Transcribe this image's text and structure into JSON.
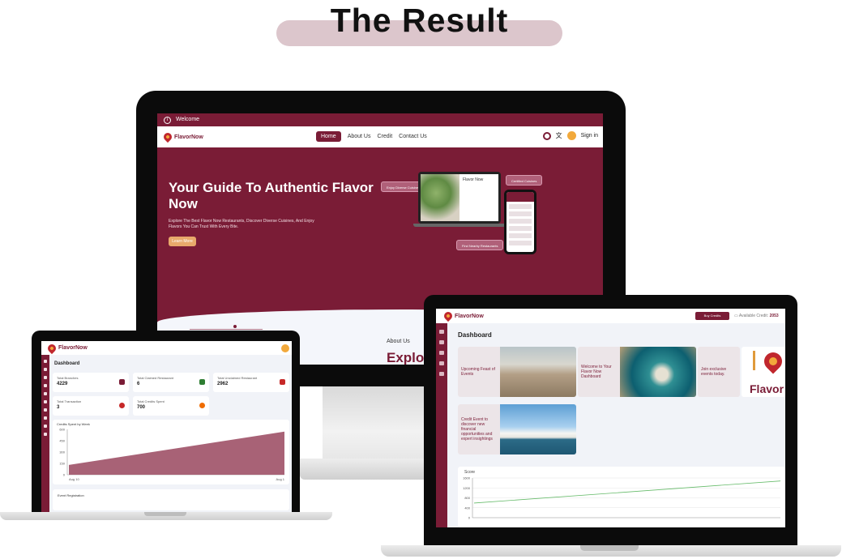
{
  "heading": "The Result",
  "colors": {
    "brand": "#7a1c36",
    "accent": "#f2a93b",
    "pill": "#dcc6cc",
    "button": "#e8a96b"
  },
  "desktop": {
    "welcome_text": "Welcome",
    "logo_text": "FlavorNow",
    "nav": {
      "home": "Home",
      "about": "About Us",
      "credit": "Credit",
      "contact": "Contact Us",
      "signin": "Sign in"
    },
    "hero": {
      "title": "Your Guide To Authentic Flavor Now",
      "subtitle": "Explore The Best Flavor Now Restaurants, Discover Diverse Cuisines, And Enjoy Flavors You Can Trust With Every Bite.",
      "button": "Learn More",
      "chip_left": "Enjoy Diverse Cuisines",
      "chip_right": "Certified Cuisines",
      "chip_bottom": "Find Nearby Restaurants",
      "mock_title": "Flavor Now"
    },
    "about_label": "About Us",
    "explore_label": "Explo"
  },
  "tablet": {
    "logo_text": "FlavorNow",
    "title": "Dashboard",
    "stats": [
      {
        "label": "Total Branches",
        "value": "4229",
        "icon": "store-icon",
        "color": "#7a1c36"
      },
      {
        "label": "Total Claimed Restaurant",
        "value": "6",
        "icon": "fork-knife-icon",
        "color": "#2e7d32"
      },
      {
        "label": "Total Unclaimed Restaurant",
        "value": "2962",
        "icon": "no-food-icon",
        "color": "#c62828"
      },
      {
        "label": "Total Transaction",
        "value": "3",
        "icon": "dollar-icon",
        "color": "#c62828"
      },
      {
        "label": "Total Credits Spent",
        "value": "700",
        "icon": "dollar-icon",
        "color": "#ef6c00"
      }
    ],
    "chart_title": "Credits Spent by Week",
    "event_title": "Event Registration"
  },
  "laptop": {
    "logo_text": "FlavorNow",
    "buy_credits": "Buy Credits",
    "credit_label": "Available Credit:",
    "credit_value": "2053",
    "title": "Dashboard",
    "cards": [
      {
        "text": "Upcoming Feast of Events"
      },
      {
        "text": "Welcome to Your Flavor Now Dashboard"
      },
      {
        "text": "Join exclusive events today."
      },
      {
        "text": "Credit Event to discover new financial opportunities and expert insightings"
      }
    ],
    "brand_word": "Flavor",
    "chart_title": "Score"
  },
  "chart_data": [
    {
      "type": "area",
      "title": "Credits Spent by Week",
      "x": [
        "Aug 10",
        "Aug 1"
      ],
      "y": [
        130,
        570
      ],
      "yticks": [
        0,
        150,
        300,
        450,
        600
      ],
      "ylim": [
        0,
        600
      ],
      "color": "#a86276",
      "grid": false,
      "legend": "none"
    },
    {
      "type": "line",
      "title": "Score",
      "x": [
        0,
        1
      ],
      "y": [
        590,
        1480
      ],
      "yticks": [
        0,
        400,
        800,
        1200,
        1600
      ],
      "ylim": [
        0,
        1600
      ],
      "color": "#66bb6a",
      "grid": true,
      "legend": "none"
    }
  ]
}
